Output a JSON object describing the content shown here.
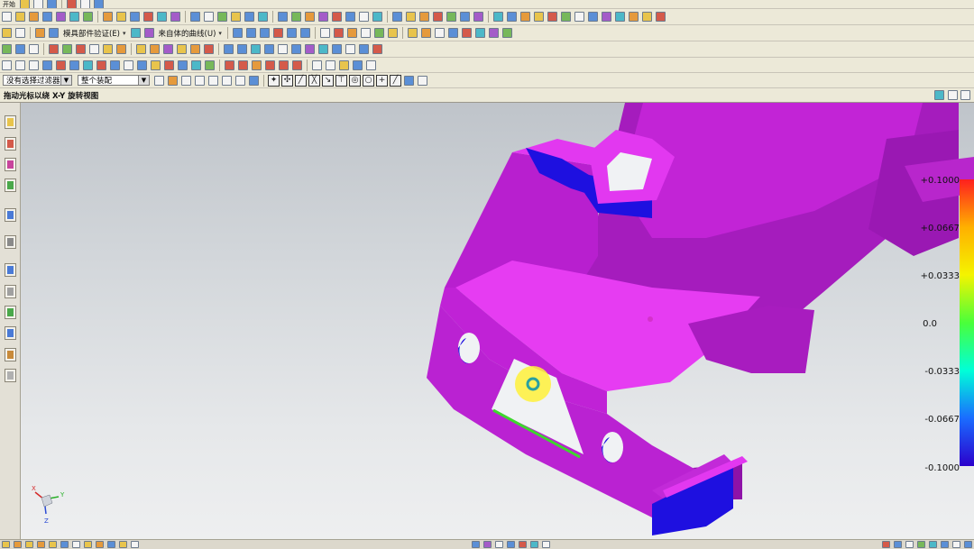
{
  "toolbars": {
    "row2_labels": [
      {
        "text": "模具部件验证(E)"
      },
      {
        "text": "来自体的曲线(U)"
      }
    ]
  },
  "selection_bar": {
    "filter_value": "没有选择过滤器",
    "scope_value": "整个装配"
  },
  "cue_line": {
    "text": "拖动光标以绕 X-Y 旋转视图"
  },
  "legend": {
    "title": "",
    "labels": [
      "+0.1000",
      "+0.0667",
      "+0.0333",
      "0.0",
      "-0.0333",
      "-0.0667",
      "-0.1000"
    ],
    "gradient_colors": [
      "#ff1f1f",
      "#ffb000",
      "#f4f400",
      "#4aff3a",
      "#00ffd8",
      "#1a6cff",
      "#2b00cc"
    ]
  },
  "model": {
    "face_color": "#c020d8",
    "highlight_color": "#e83ef0",
    "undercut_color": "#1e10e0",
    "accent_green": "#3ed62e"
  },
  "triad": {
    "axes": [
      "X",
      "Y",
      "Z"
    ]
  },
  "icons": {
    "resource_bar": [
      "assembly-navigator-icon",
      "constraint-navigator-icon",
      "part-navigator-icon",
      "reuse-library-icon",
      "web-browser-icon",
      "history-icon",
      "process-studio-icon",
      "roles-icon",
      "system-scenes-icon",
      "palettes-icon",
      "information-icon"
    ]
  }
}
